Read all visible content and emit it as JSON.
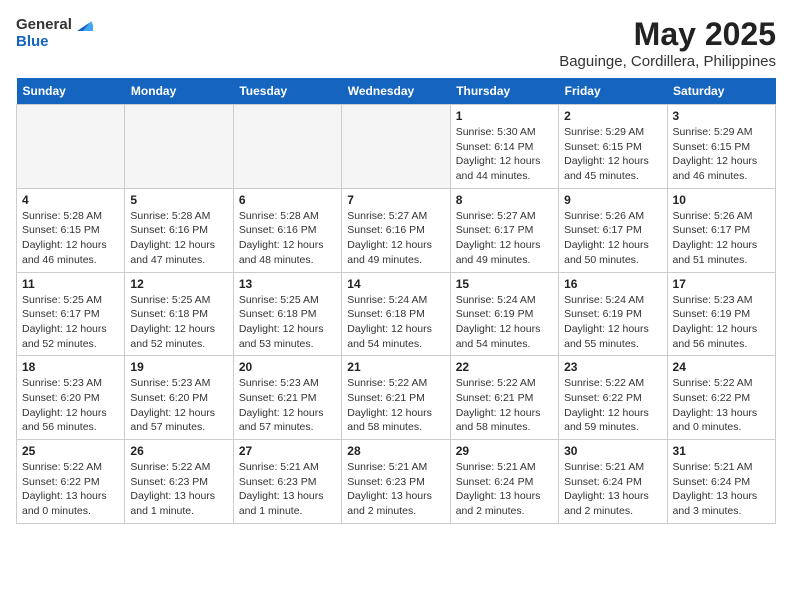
{
  "logo": {
    "general": "General",
    "blue": "Blue"
  },
  "title": "May 2025",
  "subtitle": "Baguinge, Cordillera, Philippines",
  "weekdays": [
    "Sunday",
    "Monday",
    "Tuesday",
    "Wednesday",
    "Thursday",
    "Friday",
    "Saturday"
  ],
  "weeks": [
    [
      {
        "day": "",
        "info": ""
      },
      {
        "day": "",
        "info": ""
      },
      {
        "day": "",
        "info": ""
      },
      {
        "day": "",
        "info": ""
      },
      {
        "day": "1",
        "info": "Sunrise: 5:30 AM\nSunset: 6:14 PM\nDaylight: 12 hours\nand 44 minutes."
      },
      {
        "day": "2",
        "info": "Sunrise: 5:29 AM\nSunset: 6:15 PM\nDaylight: 12 hours\nand 45 minutes."
      },
      {
        "day": "3",
        "info": "Sunrise: 5:29 AM\nSunset: 6:15 PM\nDaylight: 12 hours\nand 46 minutes."
      }
    ],
    [
      {
        "day": "4",
        "info": "Sunrise: 5:28 AM\nSunset: 6:15 PM\nDaylight: 12 hours\nand 46 minutes."
      },
      {
        "day": "5",
        "info": "Sunrise: 5:28 AM\nSunset: 6:16 PM\nDaylight: 12 hours\nand 47 minutes."
      },
      {
        "day": "6",
        "info": "Sunrise: 5:28 AM\nSunset: 6:16 PM\nDaylight: 12 hours\nand 48 minutes."
      },
      {
        "day": "7",
        "info": "Sunrise: 5:27 AM\nSunset: 6:16 PM\nDaylight: 12 hours\nand 49 minutes."
      },
      {
        "day": "8",
        "info": "Sunrise: 5:27 AM\nSunset: 6:17 PM\nDaylight: 12 hours\nand 49 minutes."
      },
      {
        "day": "9",
        "info": "Sunrise: 5:26 AM\nSunset: 6:17 PM\nDaylight: 12 hours\nand 50 minutes."
      },
      {
        "day": "10",
        "info": "Sunrise: 5:26 AM\nSunset: 6:17 PM\nDaylight: 12 hours\nand 51 minutes."
      }
    ],
    [
      {
        "day": "11",
        "info": "Sunrise: 5:25 AM\nSunset: 6:17 PM\nDaylight: 12 hours\nand 52 minutes."
      },
      {
        "day": "12",
        "info": "Sunrise: 5:25 AM\nSunset: 6:18 PM\nDaylight: 12 hours\nand 52 minutes."
      },
      {
        "day": "13",
        "info": "Sunrise: 5:25 AM\nSunset: 6:18 PM\nDaylight: 12 hours\nand 53 minutes."
      },
      {
        "day": "14",
        "info": "Sunrise: 5:24 AM\nSunset: 6:18 PM\nDaylight: 12 hours\nand 54 minutes."
      },
      {
        "day": "15",
        "info": "Sunrise: 5:24 AM\nSunset: 6:19 PM\nDaylight: 12 hours\nand 54 minutes."
      },
      {
        "day": "16",
        "info": "Sunrise: 5:24 AM\nSunset: 6:19 PM\nDaylight: 12 hours\nand 55 minutes."
      },
      {
        "day": "17",
        "info": "Sunrise: 5:23 AM\nSunset: 6:19 PM\nDaylight: 12 hours\nand 56 minutes."
      }
    ],
    [
      {
        "day": "18",
        "info": "Sunrise: 5:23 AM\nSunset: 6:20 PM\nDaylight: 12 hours\nand 56 minutes."
      },
      {
        "day": "19",
        "info": "Sunrise: 5:23 AM\nSunset: 6:20 PM\nDaylight: 12 hours\nand 57 minutes."
      },
      {
        "day": "20",
        "info": "Sunrise: 5:23 AM\nSunset: 6:21 PM\nDaylight: 12 hours\nand 57 minutes."
      },
      {
        "day": "21",
        "info": "Sunrise: 5:22 AM\nSunset: 6:21 PM\nDaylight: 12 hours\nand 58 minutes."
      },
      {
        "day": "22",
        "info": "Sunrise: 5:22 AM\nSunset: 6:21 PM\nDaylight: 12 hours\nand 58 minutes."
      },
      {
        "day": "23",
        "info": "Sunrise: 5:22 AM\nSunset: 6:22 PM\nDaylight: 12 hours\nand 59 minutes."
      },
      {
        "day": "24",
        "info": "Sunrise: 5:22 AM\nSunset: 6:22 PM\nDaylight: 13 hours\nand 0 minutes."
      }
    ],
    [
      {
        "day": "25",
        "info": "Sunrise: 5:22 AM\nSunset: 6:22 PM\nDaylight: 13 hours\nand 0 minutes."
      },
      {
        "day": "26",
        "info": "Sunrise: 5:22 AM\nSunset: 6:23 PM\nDaylight: 13 hours\nand 1 minute."
      },
      {
        "day": "27",
        "info": "Sunrise: 5:21 AM\nSunset: 6:23 PM\nDaylight: 13 hours\nand 1 minute."
      },
      {
        "day": "28",
        "info": "Sunrise: 5:21 AM\nSunset: 6:23 PM\nDaylight: 13 hours\nand 2 minutes."
      },
      {
        "day": "29",
        "info": "Sunrise: 5:21 AM\nSunset: 6:24 PM\nDaylight: 13 hours\nand 2 minutes."
      },
      {
        "day": "30",
        "info": "Sunrise: 5:21 AM\nSunset: 6:24 PM\nDaylight: 13 hours\nand 2 minutes."
      },
      {
        "day": "31",
        "info": "Sunrise: 5:21 AM\nSunset: 6:24 PM\nDaylight: 13 hours\nand 3 minutes."
      }
    ]
  ]
}
